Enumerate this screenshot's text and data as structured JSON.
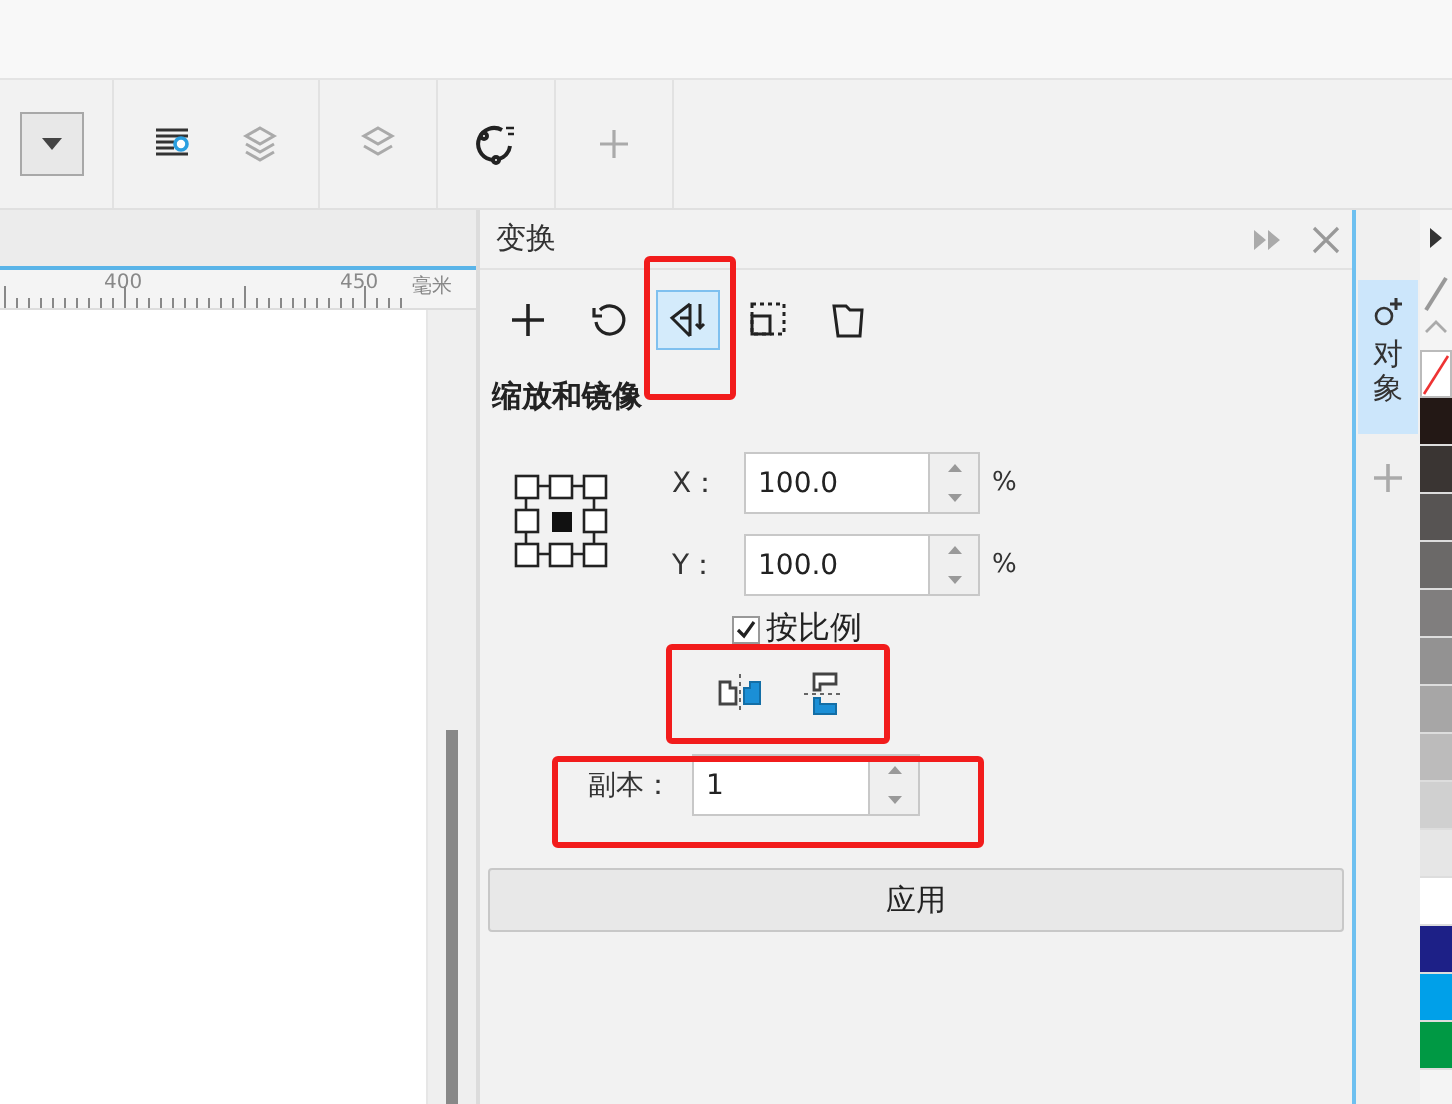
{
  "toolbar": {
    "buttons": [
      {
        "kind": "dropdown",
        "disabled": false
      },
      {
        "kind": "tool",
        "disabled": false
      },
      {
        "kind": "tool",
        "disabled": true
      },
      {
        "kind": "tool",
        "disabled": true
      },
      {
        "kind": "tool",
        "disabled": false
      },
      {
        "kind": "tool",
        "disabled": true
      }
    ]
  },
  "ruler": {
    "labels": [
      "400",
      "450"
    ],
    "unit": "毫米"
  },
  "docker": {
    "title": "变换",
    "tabs": [
      {
        "selected": false
      },
      {
        "selected": false
      },
      {
        "selected": true
      },
      {
        "selected": false
      },
      {
        "selected": false
      }
    ],
    "section_title": "缩放和镜像",
    "scale_fields": [
      {
        "label": "X：",
        "value": "100.0",
        "unit": "%"
      },
      {
        "label": "Y：",
        "value": "100.0",
        "unit": "%"
      }
    ],
    "proportional": {
      "label": "按比例",
      "checked": true
    },
    "copies": {
      "label": "副本：",
      "value": "1"
    },
    "apply_button": "应用"
  },
  "side_tabs": [
    {
      "label": "对象",
      "selected": true
    }
  ],
  "palette": [
    {
      "color": "#231815"
    },
    {
      "color": "#3a3533"
    },
    {
      "color": "#575453"
    },
    {
      "color": "#6b6968"
    },
    {
      "color": "#807e7e"
    },
    {
      "color": "#939292"
    },
    {
      "color": "#a7a6a6"
    },
    {
      "color": "#bcbbbb"
    },
    {
      "color": "#d0d0d0"
    },
    {
      "color": "#e6e6e6"
    },
    {
      "color": "#ffffff"
    },
    {
      "color": "#1d2087"
    },
    {
      "color": "#00a0e9"
    },
    {
      "color": "#009944"
    }
  ]
}
